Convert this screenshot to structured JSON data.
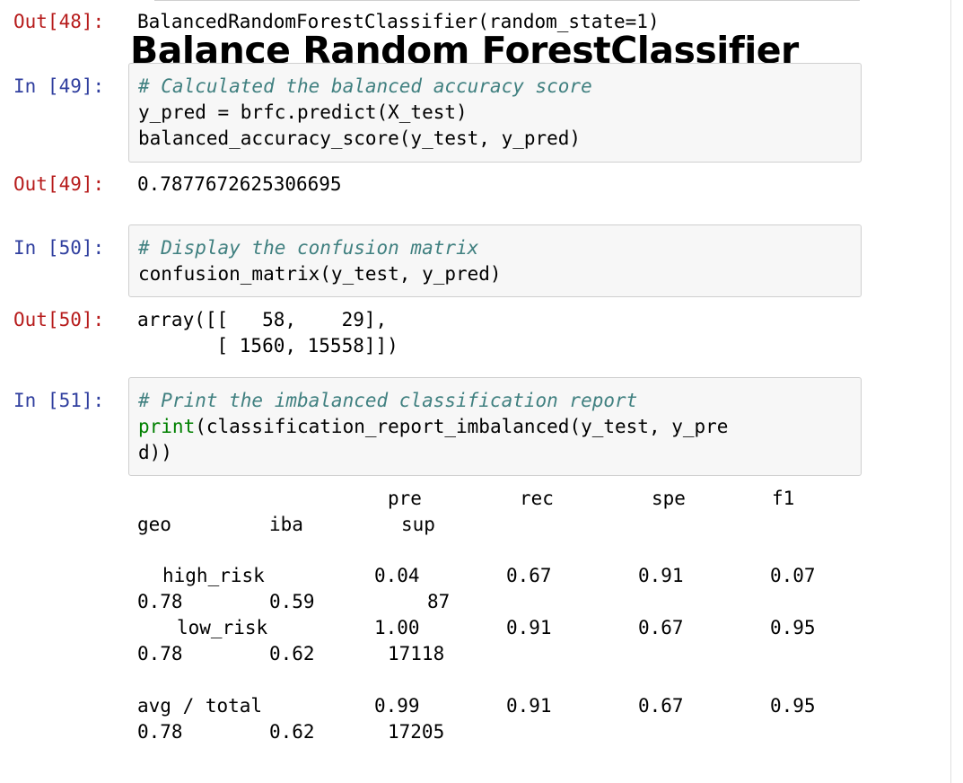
{
  "cells": {
    "out48": {
      "prompt": "Out[48]:",
      "text": "BalancedRandomForestClassifier(random_state=1)"
    },
    "markdown": {
      "heading": "Balance Random ForestClassifier"
    },
    "in49": {
      "prompt": "In [49]:",
      "comment": "# Calculated the balanced accuracy score",
      "line2": "y_pred = brfc.predict(X_test)",
      "line3": "balanced_accuracy_score(y_test, y_pred)"
    },
    "out49": {
      "prompt": "Out[49]:",
      "value": "0.7877672625306695"
    },
    "in50": {
      "prompt": "In [50]:",
      "comment": "# Display the confusion matrix",
      "line2": "confusion_matrix(y_test, y_pred)"
    },
    "out50": {
      "prompt": "Out[50]:",
      "line1": "array([[   58,    29],",
      "line2": "       [ 1560, 15558]])"
    },
    "in51": {
      "prompt": "In [51]:",
      "comment": "# Print the imbalanced classification report",
      "line2_builtin": "print",
      "line2_rest": "(classification_report_imbalanced(y_test, y_pre",
      "line3": "d))"
    }
  },
  "report": {
    "headers": {
      "pre": "pre",
      "rec": "rec",
      "spe": "spe",
      "f1": "f1",
      "geo": "geo",
      "iba": "iba",
      "sup": "sup"
    },
    "rows": [
      {
        "label": "high_risk",
        "pre": "0.04",
        "rec": "0.67",
        "spe": "0.91",
        "f1": "0.07",
        "geo": "0.78",
        "iba": "0.59",
        "sup": "87"
      },
      {
        "label": "low_risk",
        "pre": "1.00",
        "rec": "0.91",
        "spe": "0.67",
        "f1": "0.95",
        "geo": "0.78",
        "iba": "0.62",
        "sup": "17118"
      },
      {
        "label": "avg / total",
        "pre": "0.99",
        "rec": "0.91",
        "spe": "0.67",
        "f1": "0.95",
        "geo": "0.78",
        "iba": "0.62",
        "sup": "17205"
      }
    ]
  }
}
